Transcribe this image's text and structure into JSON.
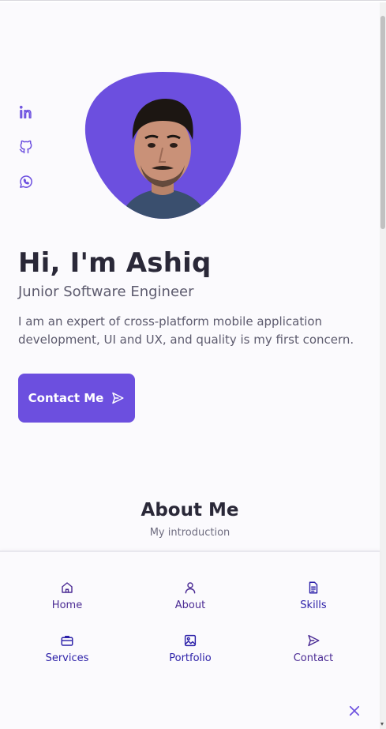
{
  "hero": {
    "name": "Hi, I'm Ashiq",
    "role": "Junior Software Engineer",
    "description": "I am an expert of cross-platform mobile application development, UI and UX, and quality is my first concern.",
    "cta_label": "Contact Me"
  },
  "social": [
    {
      "icon": "linkedin-icon"
    },
    {
      "icon": "github-icon"
    },
    {
      "icon": "whatsapp-icon"
    }
  ],
  "about": {
    "title": "About Me",
    "subtitle": "My introduction"
  },
  "nav": {
    "items": [
      {
        "label": "Home",
        "icon": "home-icon"
      },
      {
        "label": "About",
        "icon": "user-icon"
      },
      {
        "label": "Skills",
        "icon": "file-icon"
      },
      {
        "label": "Services",
        "icon": "briefcase-icon"
      },
      {
        "label": "Portfolio",
        "icon": "image-icon"
      },
      {
        "label": "Contact",
        "icon": "send-icon"
      }
    ],
    "close_icon": "close-icon"
  },
  "colors": {
    "accent": "#6c4fdf",
    "background": "#fbfafd",
    "title": "#2a2838",
    "text": "#5d5b6e"
  }
}
